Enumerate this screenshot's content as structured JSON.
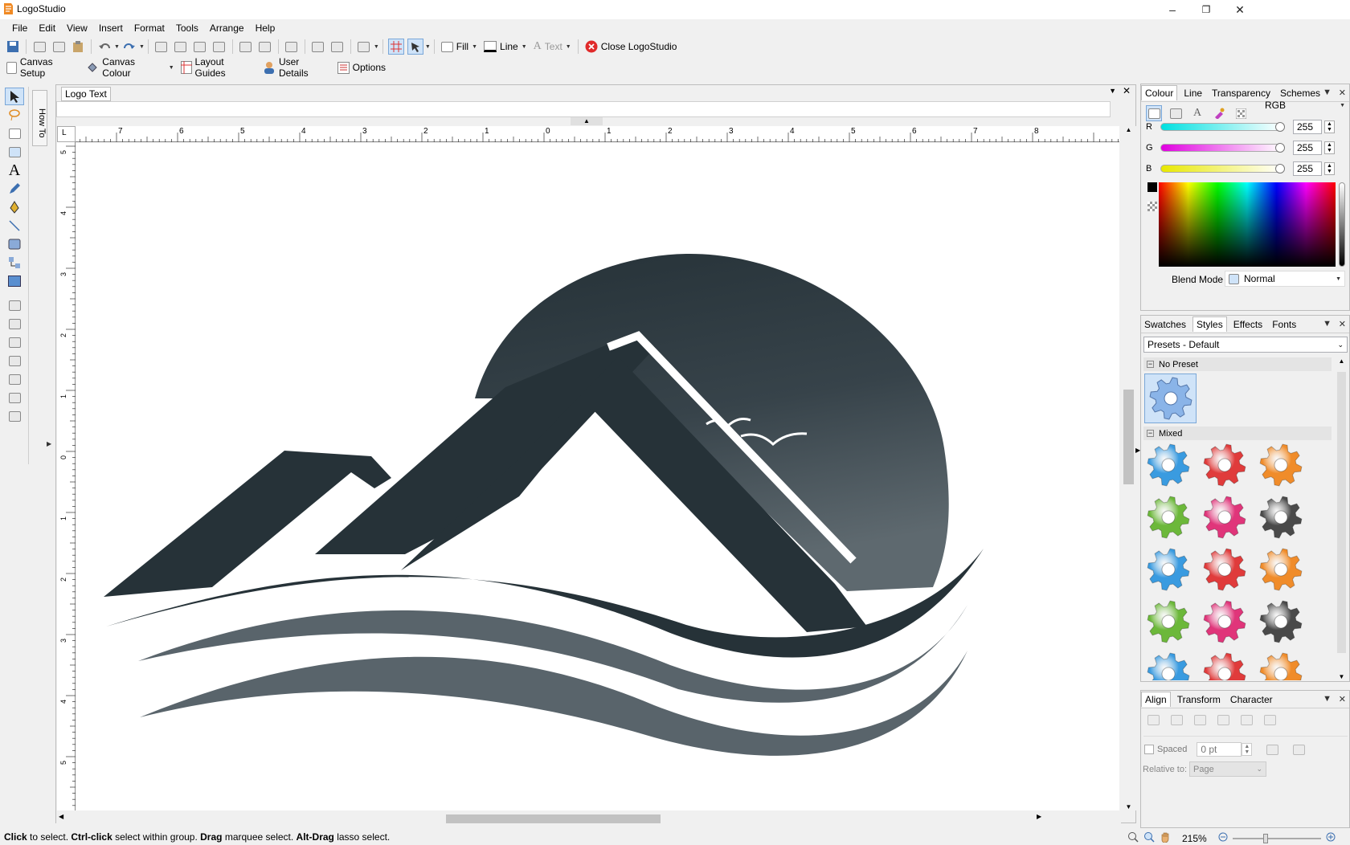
{
  "window": {
    "title": "LogoStudio",
    "min": "–",
    "max": "❐",
    "close": "✕"
  },
  "menu": [
    "File",
    "Edit",
    "View",
    "Insert",
    "Format",
    "Tools",
    "Arrange",
    "Help"
  ],
  "toolbar1": {
    "fill_label": "Fill",
    "line_label": "Line",
    "text_label": "Text",
    "close_label": "Close LogoStudio"
  },
  "toolbar2": {
    "canvas_setup": "Canvas Setup",
    "canvas_colour": "Canvas Colour",
    "layout_guides": "Layout Guides",
    "user_details": "User Details",
    "options": "Options"
  },
  "side_tab": "How To",
  "document": {
    "tab": "Logo Text",
    "text_value": ""
  },
  "ruler": {
    "top": [
      "7",
      "6",
      "5",
      "4",
      "3",
      "2",
      "1",
      "0",
      "1",
      "2",
      "3",
      "4",
      "5",
      "6",
      "7",
      "8"
    ],
    "left": [
      "5",
      "4",
      "3",
      "2",
      "1",
      "0",
      "1",
      "2",
      "3",
      "4",
      "5"
    ]
  },
  "colour_panel": {
    "tabs": [
      "Colour",
      "Line",
      "Transparency",
      "Schemes"
    ],
    "mode": "RGB",
    "r_label": "R",
    "g_label": "G",
    "b_label": "B",
    "r": "255",
    "g": "255",
    "b": "255",
    "blend_label": "Blend Mode",
    "blend_value": "Normal"
  },
  "styles_panel": {
    "tabs": [
      "Swatches",
      "Styles",
      "Effects",
      "Fonts"
    ],
    "preset": "Presets - Default",
    "group1": "No Preset",
    "group2": "Mixed"
  },
  "align_panel": {
    "tabs": [
      "Align",
      "Transform",
      "Character"
    ],
    "spaced_label": "Spaced",
    "spaced_value": "0 pt",
    "relative_label": "Relative to:",
    "relative_value": "Page"
  },
  "status": {
    "hint_parts": [
      "Click",
      " to select. ",
      "Ctrl-click",
      " select within group. ",
      "Drag",
      " marquee select. ",
      "Alt-Drag",
      " lasso select."
    ],
    "zoom": "215%"
  },
  "colors": {
    "logo_dark": "#263238",
    "logo_wave": "#59646b",
    "accent": "#0078d7"
  },
  "gear_colors": [
    "#3a9be0",
    "#e03b3b",
    "#f08c2a",
    "#6cb83a",
    "#e0357a",
    "#4a4a4a",
    "#3a9be0",
    "#e03b3b",
    "#f08c2a",
    "#6cb83a",
    "#e0357a",
    "#4a4a4a"
  ]
}
